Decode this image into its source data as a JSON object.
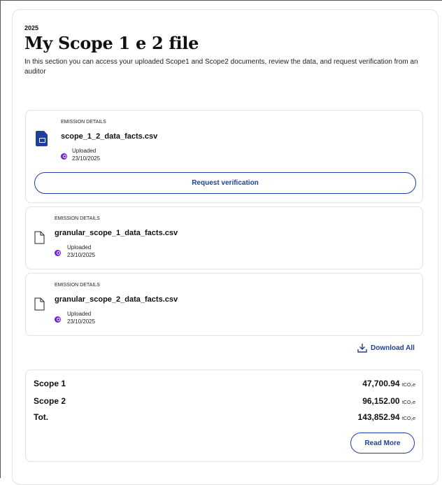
{
  "header": {
    "year": "2025",
    "title": "My Scope 1 e 2 file",
    "description": "In this section you can access your uploaded Scope1 and Scope2 documents, review the data, and request verification from an auditor"
  },
  "files": [
    {
      "section_label": "EMISSION DETAILS",
      "filename": "scope_1_2_data_facts.csv",
      "status": "Uploaded",
      "date": "23/10/2025",
      "icon": "file-folder-icon",
      "action_label": "Request verification"
    },
    {
      "section_label": "EMISSION DETAILS",
      "filename": "granular_scope_1_data_facts.csv",
      "status": "Uploaded",
      "date": "23/10/2025",
      "icon": "file-icon"
    },
    {
      "section_label": "EMISSION DETAILS",
      "filename": "granular_scope_2_data_facts.csv",
      "status": "Uploaded",
      "date": "23/10/2025",
      "icon": "file-icon"
    }
  ],
  "download_all_label": "Download All",
  "summary": {
    "rows": [
      {
        "label": "Scope 1",
        "value": "47,700.94",
        "unit": "tCO₂e"
      },
      {
        "label": "Scope 2",
        "value": "96,152.00",
        "unit": "tCO₂e"
      },
      {
        "label": "Tot.",
        "value": "143,852.94",
        "unit": "tCO₂e"
      }
    ],
    "read_more_label": "Read More"
  },
  "colors": {
    "accent": "#1f3f9e",
    "status": "#6b1fd6"
  }
}
